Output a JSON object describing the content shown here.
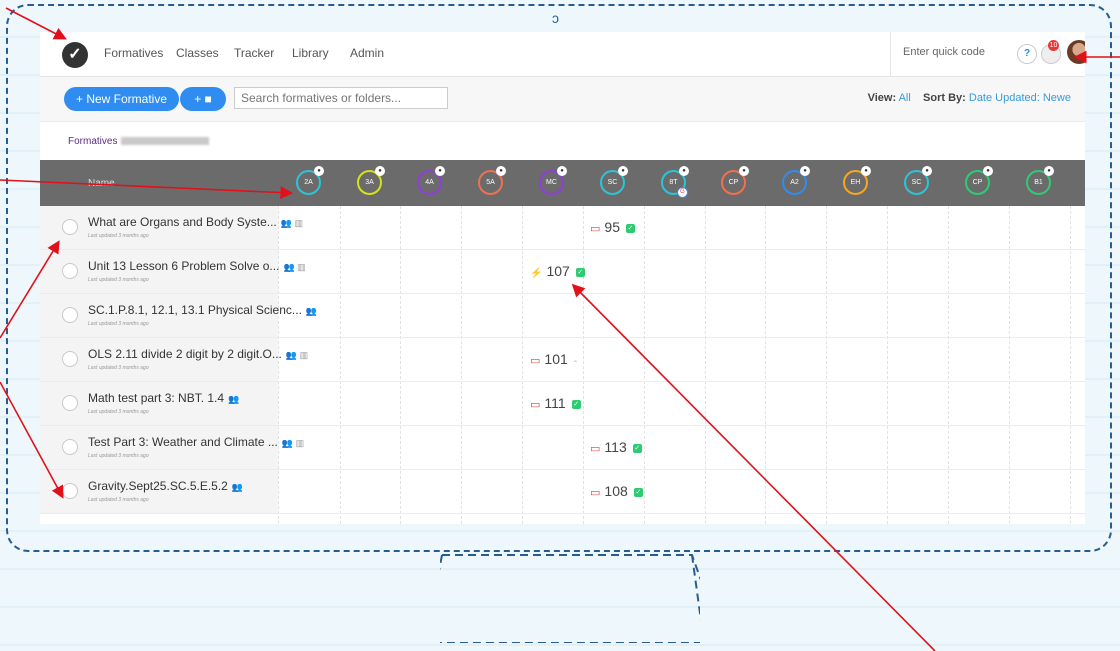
{
  "nav": {
    "logo": "✓",
    "links": [
      "Formatives",
      "Classes",
      "Tracker",
      "Library",
      "Admin"
    ],
    "quick_code": "Enter quick code",
    "help": "?",
    "notif_count": "10"
  },
  "toolbar": {
    "new_label": "+ New Formative",
    "folder_label": "+ ■",
    "search_placeholder": "Search formatives or folders...",
    "view_label": "View:",
    "view_value": "All",
    "sort_label": "Sort By:",
    "sort_value": "Date Updated: Newe"
  },
  "breadcrumb": {
    "root": "Formatives"
  },
  "table": {
    "name_header": "Name",
    "classes": [
      {
        "code": "2A",
        "color": "#29c5d8"
      },
      {
        "code": "3A",
        "color": "#d4e21b"
      },
      {
        "code": "4A",
        "color": "#8e3fd6"
      },
      {
        "code": "5A",
        "color": "#f0714f"
      },
      {
        "code": "MC",
        "color": "#8e3fd6"
      },
      {
        "code": "SC",
        "color": "#29c5d8"
      },
      {
        "code": "8T",
        "color": "#29c5d8"
      },
      {
        "code": "CP",
        "color": "#f0714f"
      },
      {
        "code": "A2",
        "color": "#2f8cf0"
      },
      {
        "code": "EH",
        "color": "#f5a623"
      },
      {
        "code": "SC",
        "color": "#29c5d8"
      },
      {
        "code": "CP",
        "color": "#2ecc71"
      },
      {
        "code": "B1",
        "color": "#2ecc71"
      }
    ],
    "rows": [
      {
        "title": "What are Organs and Body Syste...",
        "updated": "Last updated 3 months ago",
        "score": "95"
      },
      {
        "title": "Unit 13 Lesson 6 Problem Solve o...",
        "updated": "Last updated 3 months ago",
        "score": "107"
      },
      {
        "title": "SC.1.P.8.1, 12.1, 13.1 Physical Scienc...",
        "updated": "Last updated 3 months ago",
        "score": ""
      },
      {
        "title": "OLS 2.11 divide 2 digit by 2 digit.O...",
        "updated": "Last updated 3 months ago",
        "score": "101"
      },
      {
        "title": "Math test part 3: NBT. 1.4",
        "updated": "Last updated 3 months ago",
        "score": "111"
      },
      {
        "title": "Test Part 3: Weather and Climate ...",
        "updated": "Last updated 3 months ago",
        "score": "113"
      },
      {
        "title": "Gravity.Sept25.SC.5.E.5.2",
        "updated": "Last updated 3 months ago",
        "score": "108"
      }
    ]
  }
}
